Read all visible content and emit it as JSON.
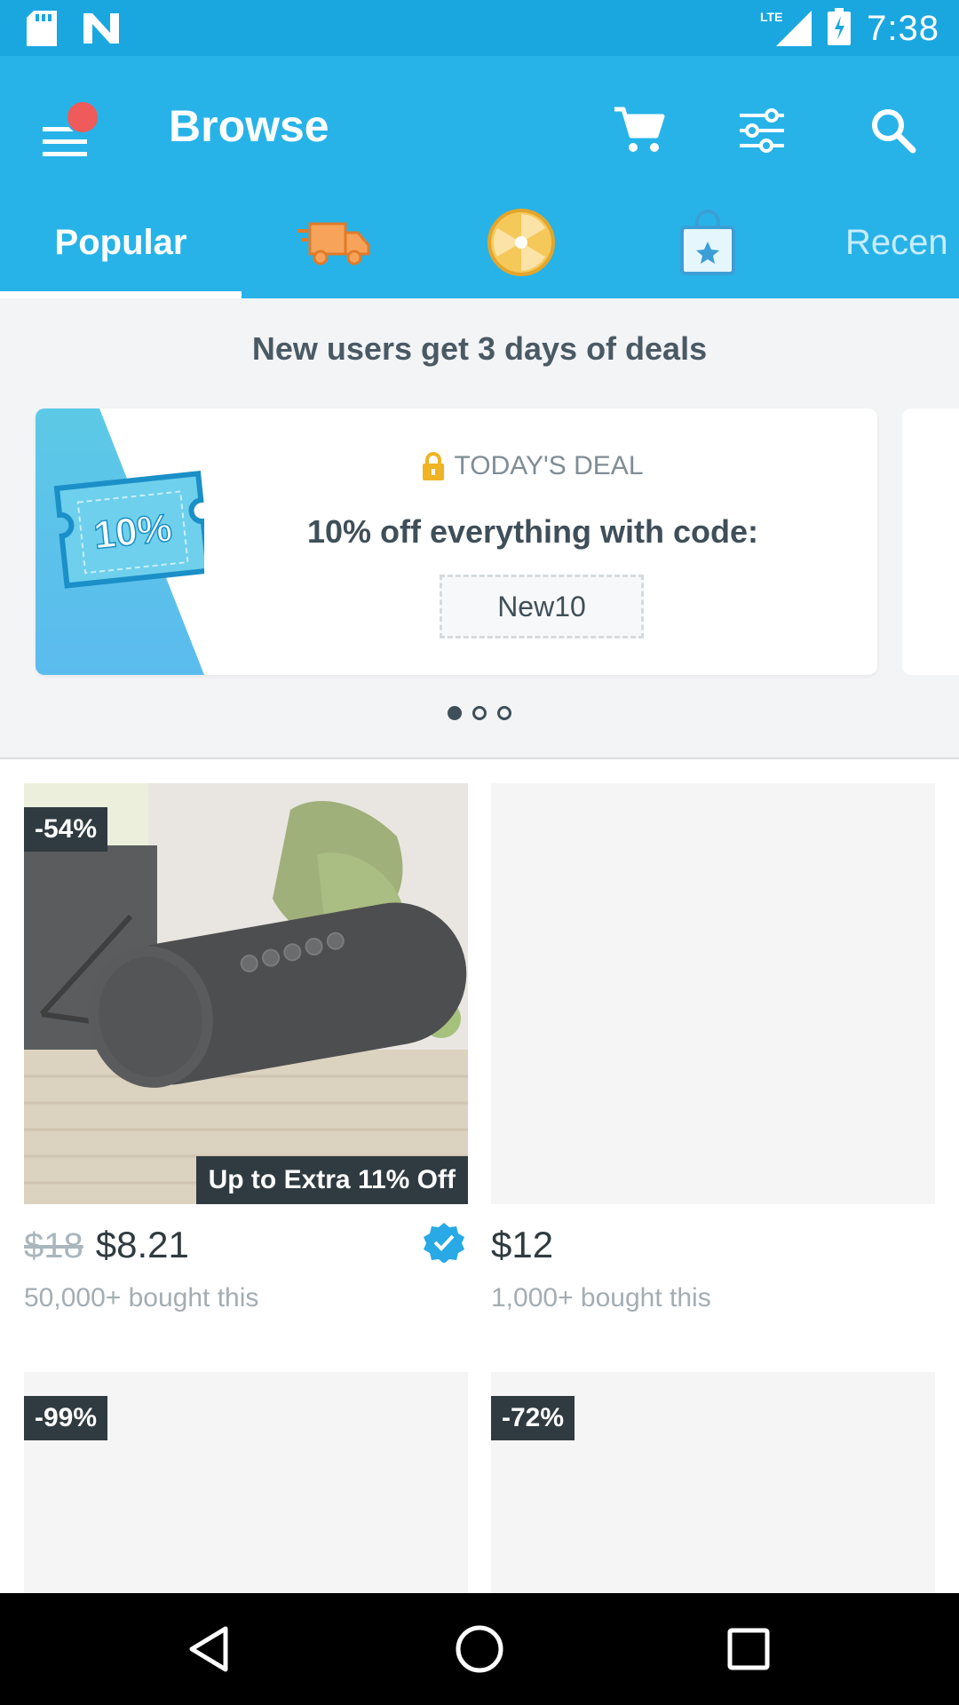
{
  "status_bar": {
    "network": "LTE",
    "time": "7:38"
  },
  "app_bar": {
    "title": "Browse"
  },
  "tabs": [
    {
      "label": "Popular",
      "active": true
    },
    {
      "icon": "delivery-truck-icon"
    },
    {
      "icon": "prize-wheel-icon"
    },
    {
      "icon": "shopping-bag-star-icon"
    },
    {
      "label": "Recen"
    }
  ],
  "promo": {
    "heading": "New users get 3 days of deals"
  },
  "deal": {
    "badge_text": "10%",
    "tag": "TODAY'S DEAL",
    "title": "10% off everything with code:",
    "code": "New10"
  },
  "carousel": {
    "total": 3,
    "active_index": 0
  },
  "products": [
    {
      "badge": "-54%",
      "extra": "Up to Extra 11% Off",
      "old_price": "$18",
      "price": "$8.21",
      "bought": "50,000+ bought this",
      "verified": true
    },
    {
      "badge": "",
      "extra": "",
      "old_price": "",
      "price": "$12",
      "bought": "1,000+ bought this",
      "verified": false
    },
    {
      "badge": "-99%"
    },
    {
      "badge": "-72%"
    }
  ],
  "colors": {
    "primary": "#27b3e8",
    "status_bar": "#1aa7e0",
    "badge_bg": "#2f3b40",
    "verified": "#29a9e6",
    "lock": "#f0b323"
  }
}
